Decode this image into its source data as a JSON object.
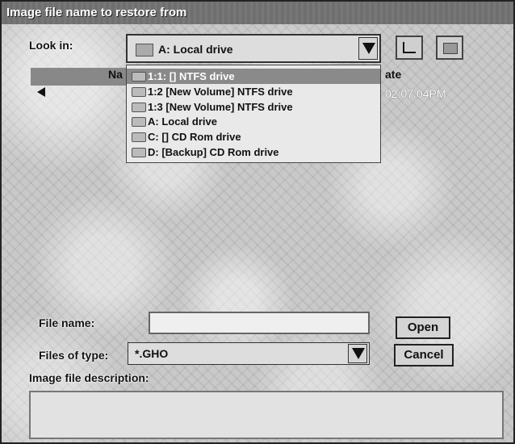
{
  "window": {
    "title": "Image file name to restore from"
  },
  "look_in": {
    "label": "Look in:",
    "value": "A: Local drive"
  },
  "list": {
    "header_name": "Na",
    "header_date": "ate",
    "date_fragment": "02:07:04PM"
  },
  "dropdown_items": [
    {
      "label": "1:1: [] NTFS drive",
      "selected": true
    },
    {
      "label": "1:2 [New Volume] NTFS drive",
      "selected": false
    },
    {
      "label": "1:3 [New Volume] NTFS drive",
      "selected": false
    },
    {
      "label": "A: Local drive",
      "selected": false
    },
    {
      "label": "C: [] CD Rom drive",
      "selected": false
    },
    {
      "label": "D: [Backup] CD Rom drive",
      "selected": false
    }
  ],
  "file_name": {
    "label": "File name:",
    "value": ""
  },
  "files_of_type": {
    "label": "Files of type:",
    "value": "*.GHO"
  },
  "description": {
    "label": "Image file description:",
    "value": ""
  },
  "buttons": {
    "open": "Open",
    "cancel": "Cancel"
  },
  "icons": [
    "drive-icon",
    "dropdown-arrow-icon",
    "up-folder-icon",
    "new-folder-icon",
    "scroll-left-icon"
  ]
}
